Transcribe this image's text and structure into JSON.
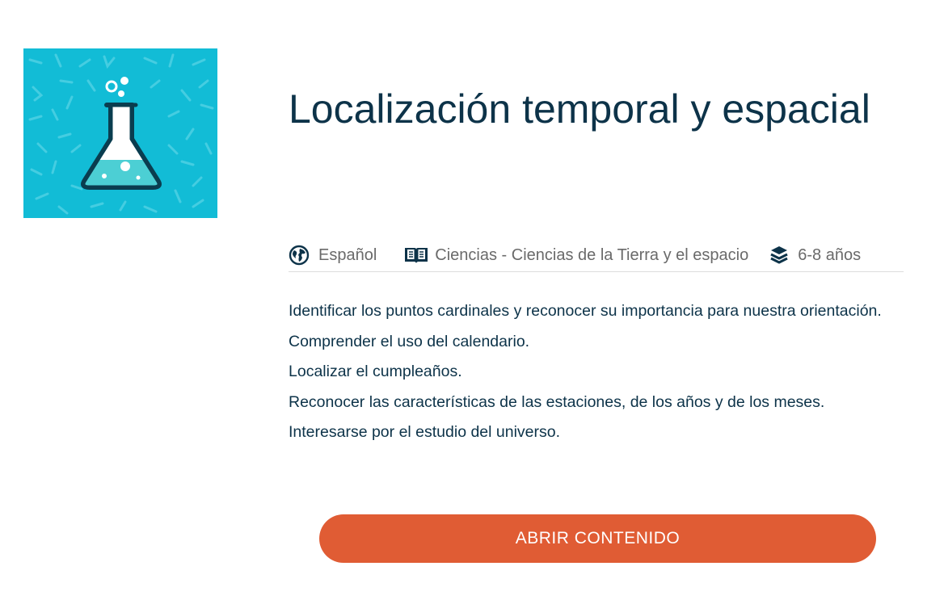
{
  "content": {
    "title": "Localización temporal y espacial",
    "thumbnail_icon": "lab-flask-icon",
    "meta": {
      "language": {
        "icon": "globe-icon",
        "label": "Español"
      },
      "subject": {
        "icon": "open-book-icon",
        "label": "Ciencias - Ciencias de la Tierra y el espacio"
      },
      "age": {
        "icon": "layers-icon",
        "label": "6-8 años"
      }
    },
    "objectives": [
      "Identificar los puntos cardinales y reconocer su importancia para nuestra orientación.",
      "Comprender el uso del calendario.",
      "Localizar el cumpleaños.",
      "Reconocer las características de las estaciones, de los años y de los meses.",
      "Interesarse por el estudio del universo."
    ],
    "open_button_label": "ABRIR CONTENIDO"
  },
  "colors": {
    "title_text": "#0d3349",
    "meta_text": "#6a6a6a",
    "thumbnail_bg": "#12bcd6",
    "button_bg": "#e05c34",
    "button_text": "#ffffff"
  }
}
